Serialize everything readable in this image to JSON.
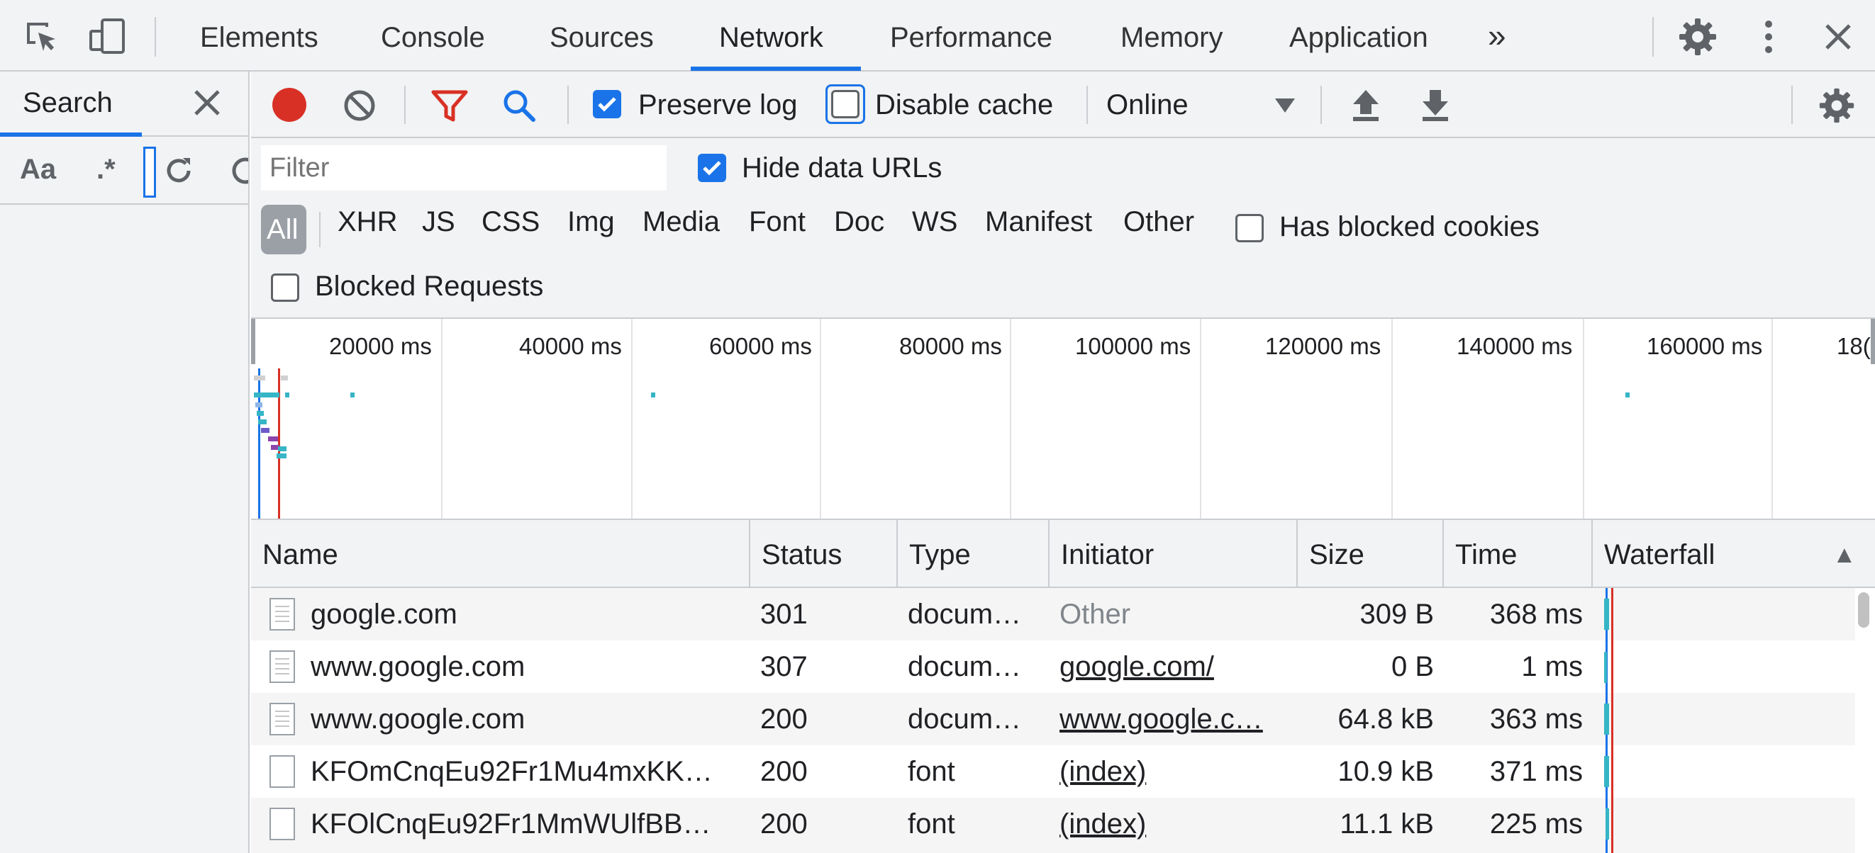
{
  "topbar": {
    "tabs": [
      "Elements",
      "Console",
      "Sources",
      "Network",
      "Performance",
      "Memory",
      "Application"
    ],
    "active_tab": "Network",
    "more_label": "»",
    "icons": [
      "inspect-element-icon",
      "device-toolbar-icon",
      "settings-gear-icon",
      "more-vertical-icon",
      "close-icon"
    ]
  },
  "drawer": {
    "tab_label": "Search",
    "match_case_label": "Aa",
    "regex_label": ".*"
  },
  "toolbar": {
    "preserve_log_label": "Preserve log",
    "preserve_log_checked": true,
    "disable_cache_label": "Disable cache",
    "disable_cache_checked": false,
    "throttling_value": "Online",
    "colors": {
      "record": "#d93025",
      "filter": "#d93025",
      "search": "#1a73e8"
    }
  },
  "filter": {
    "placeholder": "Filter",
    "hide_data_urls_label": "Hide data URLs",
    "hide_data_urls_checked": true,
    "types": [
      "All",
      "XHR",
      "JS",
      "CSS",
      "Img",
      "Media",
      "Font",
      "Doc",
      "WS",
      "Manifest",
      "Other"
    ],
    "active_type": "All",
    "has_blocked_cookies_label": "Has blocked cookies",
    "blocked_requests_label": "Blocked Requests"
  },
  "overview": {
    "ticks": [
      "20000 ms",
      "40000 ms",
      "60000 ms",
      "80000 ms",
      "100000 ms",
      "120000 ms",
      "140000 ms",
      "160000 ms",
      "18("
    ]
  },
  "table": {
    "headers": {
      "name": "Name",
      "status": "Status",
      "type": "Type",
      "initiator": "Initiator",
      "size": "Size",
      "time": "Time",
      "waterfall": "Waterfall",
      "sort_indicator": "▲"
    },
    "rows": [
      {
        "name": "google.com",
        "status": "301",
        "type": "docum…",
        "initiator": "Other",
        "size": "309 B",
        "time": "368 ms"
      },
      {
        "name": "www.google.com",
        "status": "307",
        "type": "docum…",
        "initiator": "google.com/",
        "size": "0 B",
        "time": "1 ms"
      },
      {
        "name": "www.google.com",
        "status": "200",
        "type": "docum…",
        "initiator": "www.google.c…",
        "size": "64.8 kB",
        "time": "363 ms"
      },
      {
        "name": "KFOmCnqEu92Fr1Mu4mxKK…",
        "status": "200",
        "type": "font",
        "initiator": "(index)",
        "size": "10.9 kB",
        "time": "371 ms"
      },
      {
        "name": "KFOlCnqEu92Fr1MmWUlfBB…",
        "status": "200",
        "type": "font",
        "initiator": "(index)",
        "size": "11.1 kB",
        "time": "225 ms"
      }
    ]
  }
}
